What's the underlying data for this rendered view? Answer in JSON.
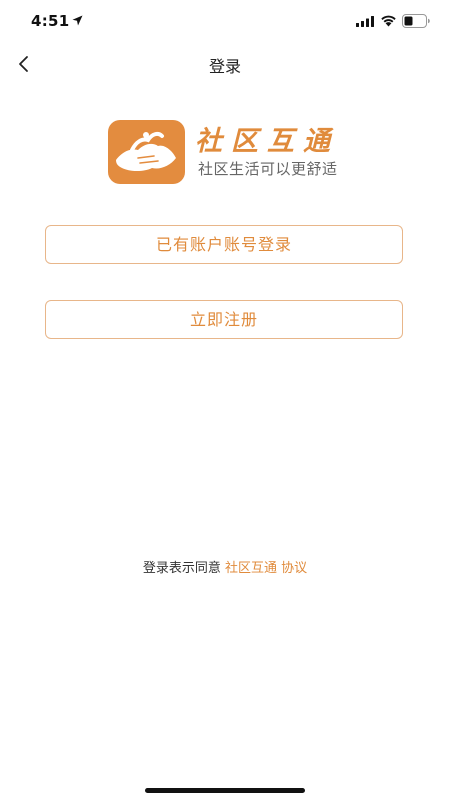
{
  "status_bar": {
    "time": "4:51"
  },
  "nav": {
    "title": "登录"
  },
  "brand": {
    "name": "社区互通",
    "slogan": "社区生活可以更舒适"
  },
  "buttons": {
    "login": "已有账户账号登录",
    "register": "立即注册"
  },
  "agreement": {
    "prefix": "登录表示同意",
    "app_link": "社区互通",
    "protocol_link": "协议"
  },
  "colors": {
    "accent": "#e08b3c",
    "logo_bg": "#e38c3f",
    "button_border": "#e8b68a"
  },
  "icons": [
    "location-arrow-icon",
    "signal-icon",
    "wifi-icon",
    "battery-icon",
    "back-chevron-icon",
    "app-logo"
  ]
}
